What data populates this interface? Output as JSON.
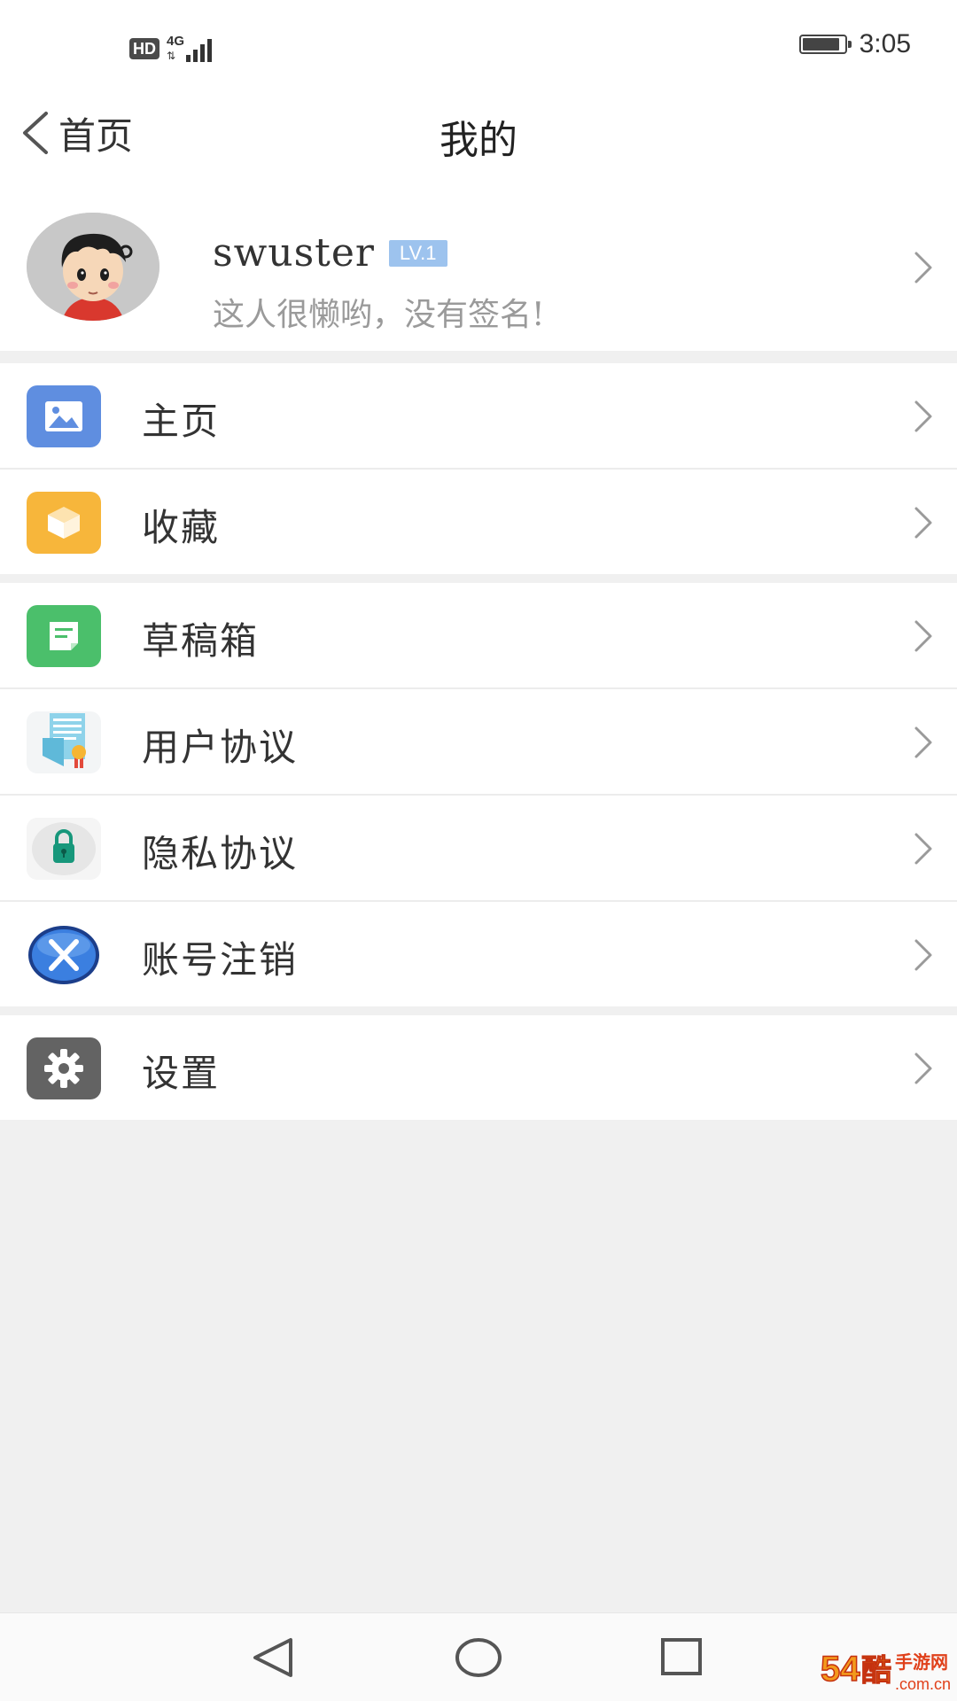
{
  "status_bar": {
    "hd": "HD",
    "network": "4G",
    "time": "3:05",
    "battery_level": 0.9
  },
  "header": {
    "back_label": "首页",
    "title": "我的"
  },
  "profile": {
    "username": "swuster",
    "level_badge": "LV.1",
    "signature": "这人很懒哟，没有签名!"
  },
  "menu_groups": [
    [
      {
        "label": "主页",
        "icon": "image-icon",
        "color": "#5f8ee0"
      },
      {
        "label": "收藏",
        "icon": "box-icon",
        "color": "#f7b63b"
      }
    ],
    [
      {
        "label": "草稿箱",
        "icon": "draft-icon",
        "color": "#4bbf6b"
      },
      {
        "label": "用户协议",
        "icon": "certificate-icon",
        "color": "#5fb9d9"
      },
      {
        "label": "隐私协议",
        "icon": "lock-icon",
        "color": "#17977b"
      },
      {
        "label": "账号注销",
        "icon": "cancel-x-icon",
        "color": "#2c6fd6"
      }
    ],
    [
      {
        "label": "设置",
        "icon": "gear-icon",
        "color": "#636363"
      }
    ]
  ],
  "watermark": "54酷手游网 .com.cn",
  "colors": {
    "background": "#f0f0f0",
    "surface": "#ffffff",
    "badge": "#9dc3ee"
  }
}
